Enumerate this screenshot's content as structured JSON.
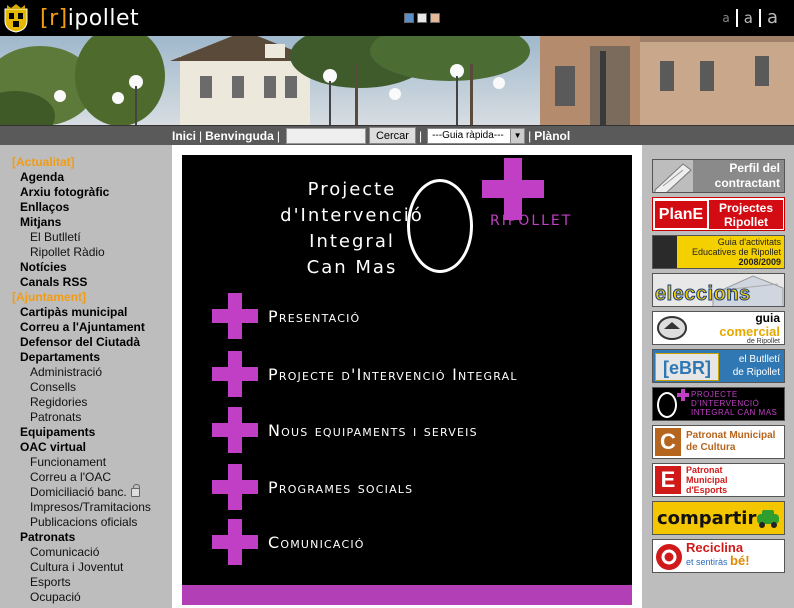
{
  "header": {
    "logo_bracket": "[r]",
    "logo_text": "ipollet",
    "color_switches": [
      "#5b8ec9",
      "#e8e8e8",
      "#e5b999"
    ],
    "font_sizes": [
      "a",
      "a",
      "a"
    ]
  },
  "nav": {
    "inici": "Inici",
    "benvinguda": "Benvinguda",
    "search_value": "",
    "search_button": "Cercar",
    "guide_select": "---Guia ràpida---",
    "planol": "Plànol",
    "separator": "|"
  },
  "sidebar": {
    "items": [
      {
        "type": "sec",
        "label": "[Actualitat]"
      },
      {
        "type": "it",
        "label": "Agenda"
      },
      {
        "type": "it",
        "label": "Arxiu fotogràfic"
      },
      {
        "type": "it",
        "label": "Enllaços"
      },
      {
        "type": "it",
        "label": "Mitjans"
      },
      {
        "type": "sub",
        "label": "El Butlletí"
      },
      {
        "type": "sub",
        "label": "Ripollet Ràdio"
      },
      {
        "type": "it",
        "label": "Notícies"
      },
      {
        "type": "it",
        "label": "Canals RSS"
      },
      {
        "type": "sec",
        "label": "[Ajuntament]"
      },
      {
        "type": "it",
        "label": "Cartipàs municipal"
      },
      {
        "type": "it",
        "label": "Correu a l'Ajuntament"
      },
      {
        "type": "it",
        "label": "Defensor del Ciutadà"
      },
      {
        "type": "it",
        "label": "Departaments"
      },
      {
        "type": "sub",
        "label": "Administració"
      },
      {
        "type": "sub",
        "label": "Consells"
      },
      {
        "type": "sub",
        "label": "Regidories"
      },
      {
        "type": "sub",
        "label": "Patronats"
      },
      {
        "type": "it",
        "label": "Equipaments"
      },
      {
        "type": "it",
        "label": "OAC virtual"
      },
      {
        "type": "sub",
        "label": "Funcionament"
      },
      {
        "type": "sub",
        "label": "Correu a l'OAC"
      },
      {
        "type": "sub",
        "label": "Domiciliació banc.",
        "lock": true
      },
      {
        "type": "sub",
        "label": "Impresos/Tramitacions"
      },
      {
        "type": "sub",
        "label": "Publicacions oficials"
      },
      {
        "type": "it",
        "label": "Patronats"
      },
      {
        "type": "sub",
        "label": "Comunicació"
      },
      {
        "type": "sub",
        "label": "Cultura i Joventut"
      },
      {
        "type": "sub",
        "label": "Esports"
      },
      {
        "type": "sub",
        "label": "Ocupació"
      }
    ]
  },
  "main": {
    "title_lines": [
      "Projecte",
      "d'Intervenció",
      "Integral",
      "Can Mas"
    ],
    "brand_city": "RIPOLLET",
    "accent": "#c13fc5",
    "menu": [
      "Presentació",
      "Projecte d'Intervenció Integral",
      "Nous equipaments i serveis",
      "Programes socials",
      "Comunicació"
    ]
  },
  "right_banners": {
    "perfil": [
      "Perfil del",
      "contractant"
    ],
    "plane_logo": "PlanE",
    "plane": [
      "Projectes",
      "Ripollet"
    ],
    "guia_activitats": [
      "Guia d'activitats",
      "Educatives de Ripollet",
      "2008/2009"
    ],
    "eleccions": "eleccions",
    "guia_comercial": [
      "guia",
      "comercial",
      "de Ripollet"
    ],
    "butlleti_logo": "[eBR]",
    "butlleti": [
      "el Butlletí",
      "de Ripollet"
    ],
    "canmas": [
      "PROJECTE",
      "D'INTERVENCIÓ",
      "INTEGRAL CAN MAS"
    ],
    "cultura_letter": "C",
    "cultura": [
      "Patronat Municipal",
      "de Cultura"
    ],
    "esports_letter": "E",
    "esports": [
      "Patronat",
      "Municipal",
      "d'Esports"
    ],
    "compartir": "compartir",
    "reciclina": [
      "Reciclina",
      "et sentiràs",
      "bé!"
    ]
  }
}
